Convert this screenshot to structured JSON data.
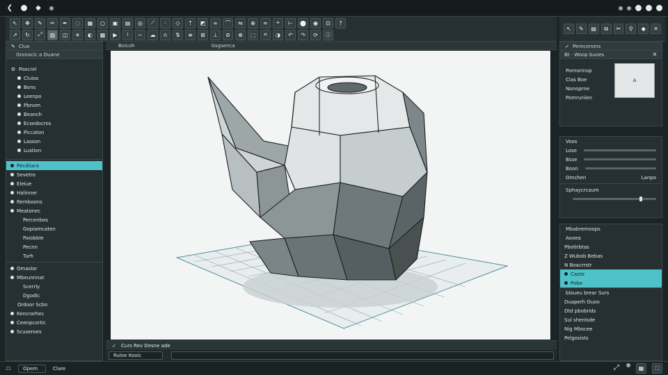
{
  "titlebar": {
    "left_icons": [
      "back-icon",
      "app-icon",
      "pin-icon",
      "bell-icon"
    ],
    "right_icons": [
      "record-icon",
      "settings-icon",
      "minimize-icon",
      "maximize-icon",
      "close-icon"
    ]
  },
  "left_panel": {
    "header_label": "Cluo",
    "subheader_label": "Gronacic a Ouane",
    "section1_title": "Poocrel",
    "section1_items": [
      "Cluios",
      "Bons",
      "Leenpo",
      "Pbnom",
      "Beanch",
      "Ecsedocros",
      "Piccaton",
      "Lasson",
      "Lustion"
    ],
    "selected_item": "Pecdiiara",
    "section2_items": [
      "Sevetro",
      "Eleiue",
      "Halinner",
      "Remboons",
      "Meatonec"
    ],
    "section2_sub": [
      "Percenbos",
      "Gopiamcaten",
      "Paiobble",
      "Pecnn",
      "Turh"
    ],
    "section3_items": [
      "Omaslor",
      "Mbeunnnat"
    ],
    "section3_sub": [
      "Scerrly",
      "Dgodlc"
    ],
    "section3_footer": "Ordoor Scbn",
    "section4_items": [
      "Kencrarhec",
      "Ceenpcortic",
      "Scuseroes"
    ],
    "footer_left": "Opem",
    "footer_right": "Clare"
  },
  "viewport": {
    "header_left": "Boicoh",
    "header_center": "Gsgsenca",
    "status_text": "Curs Rev Desne ade",
    "bottom_field": "Ruloe Kooic"
  },
  "right_panel": {
    "header_label": "Perecenons",
    "subheader_label": "Bt · Woop buoes",
    "props": [
      "Pornorinop",
      "Clas Boe",
      "Nonoprne",
      "Pomruriien"
    ],
    "preview_label": "A",
    "section2_title": "Voos",
    "section2_rows": [
      "Lose",
      "Bsse",
      "Boon"
    ],
    "section2_left": "Omchen",
    "section2_right": "Lanpo",
    "section2_dropdown": "Sphaycrcaum",
    "section3_title": "Mbabremoops",
    "section3_subtitle": "Aooea",
    "section3_items": [
      "Pbotlrbtas",
      "Z Wubob Bebas",
      "N Boacrrstr"
    ],
    "section3_selected": [
      "Caste",
      "Pobe"
    ],
    "section4_title": "bloueu brear Surs",
    "section4_items": [
      "Duaperh Ouoo",
      "Dtd pbobrids",
      "Sul shenlsde",
      "Nig Mbscee",
      "Pelgosists"
    ]
  },
  "colors": {
    "accent": "#4fc1c9",
    "panel": "#263033",
    "background": "#1d2426",
    "viewport": "#f3f5f5"
  }
}
